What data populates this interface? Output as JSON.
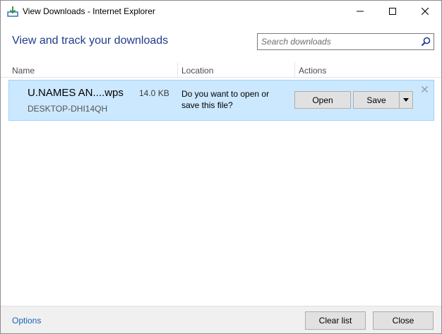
{
  "window": {
    "title": "View Downloads - Internet Explorer",
    "icons": {
      "app": "downloads-icon",
      "minimize": "minimize-icon",
      "maximize": "maximize-icon",
      "close": "close-icon"
    }
  },
  "header": {
    "title": "View and track your downloads",
    "search_placeholder": "Search downloads",
    "search_icon": "search-icon"
  },
  "columns": {
    "name": "Name",
    "location": "Location",
    "actions": "Actions"
  },
  "downloads": [
    {
      "file_name": "U.NAMES AN....wps",
      "size": "14.0 KB",
      "source": "DESKTOP-DHI14QH",
      "prompt": "Do you want to open or save this file?",
      "open_label": "Open",
      "save_label": "Save",
      "dropdown_icon": "dropdown-arrow-icon",
      "remove_icon": "close-icon"
    }
  ],
  "footer": {
    "options_label": "Options",
    "clear_label": "Clear list",
    "close_label": "Close"
  },
  "colors": {
    "heading": "#1e3c8c",
    "row_selected_bg": "#cce8ff",
    "row_selected_border": "#99d1ff",
    "link": "#1e5fb4",
    "footer_bg": "#f0f0f0"
  }
}
